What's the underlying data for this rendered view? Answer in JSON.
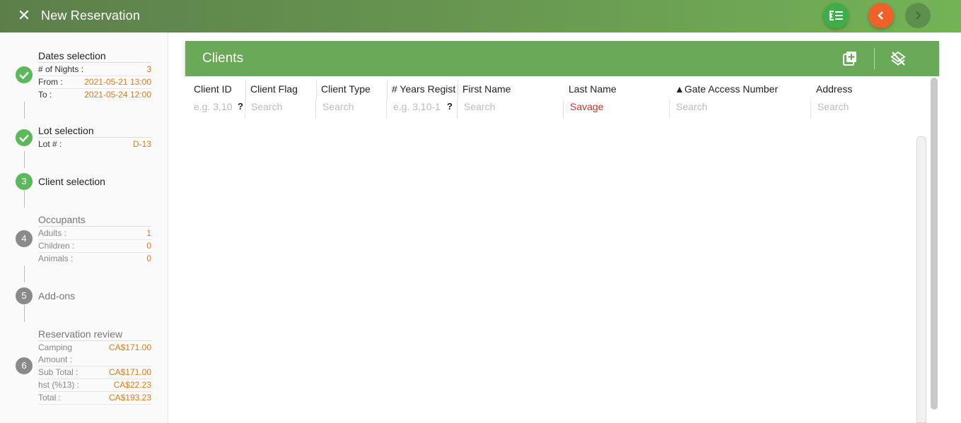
{
  "app": {
    "title": "New Reservation"
  },
  "topbar": {
    "close_icon": "close-icon",
    "buttons": [
      {
        "name": "list-toggle",
        "icon": "list-swap-icon",
        "color": "#3fae49"
      },
      {
        "name": "back",
        "icon": "chevron-left-icon",
        "color": "#f0612a"
      },
      {
        "name": "next",
        "icon": "chevron-right-icon",
        "color": "#5f8f4c"
      }
    ]
  },
  "steps": {
    "dates": {
      "title": "Dates selection",
      "number": "1",
      "status": "done",
      "rows": [
        {
          "key": "# of Nights :",
          "value": "3"
        },
        {
          "key": "From :",
          "value": "2021-05-21 13:00"
        },
        {
          "key": "To :",
          "value": "2021-05-24 12:00"
        }
      ]
    },
    "lot": {
      "title": "Lot selection",
      "number": "2",
      "status": "done",
      "rows": [
        {
          "key": "Lot # :",
          "value": "D-13"
        }
      ]
    },
    "client": {
      "title": "Client selection",
      "number": "3",
      "status": "active"
    },
    "occupants": {
      "title": "Occupants",
      "number": "4",
      "status": "todo",
      "rows": [
        {
          "key": "Adults :",
          "value": "1"
        },
        {
          "key": "Children :",
          "value": "0"
        },
        {
          "key": "Animals :",
          "value": "0"
        }
      ]
    },
    "addons": {
      "title": "Add-ons",
      "number": "5",
      "status": "todo"
    },
    "review": {
      "title": "Reservation review",
      "number": "6",
      "status": "todo",
      "rows": [
        {
          "key": "Camping",
          "value": "CA$171.00"
        },
        {
          "key": "Amount :",
          "value": ""
        },
        {
          "key": "Sub Total :",
          "value": "CA$171.00"
        },
        {
          "key": "hst (%13) :",
          "value": "CA$22.23"
        },
        {
          "key": "Total :",
          "value": "CA$193.23"
        }
      ]
    }
  },
  "panel": {
    "title": "Clients",
    "add_icon": "add-box-icon",
    "clear_filter_icon": "layers-clear-icon",
    "header_color": "#6aa957"
  },
  "table": {
    "columns": [
      {
        "label": "Client ID",
        "filter_placeholder": "e.g. 3,10",
        "filter_value": "",
        "help": "?"
      },
      {
        "label": "Client Flag",
        "filter_placeholder": "Search",
        "filter_value": "",
        "help": ""
      },
      {
        "label": "Client Type",
        "filter_placeholder": "Search",
        "filter_value": "",
        "help": ""
      },
      {
        "label": "# Years Regist",
        "filter_placeholder": "e.g. 3,10-1",
        "filter_value": "",
        "help": "?"
      },
      {
        "label": "First Name",
        "filter_placeholder": "Search",
        "filter_value": "",
        "help": ""
      },
      {
        "label": "Last Name",
        "filter_placeholder": "Search",
        "filter_value": "Savage",
        "help": ""
      },
      {
        "label": "▲Gate Access Number",
        "filter_placeholder": "Search",
        "filter_value": "",
        "help": ""
      },
      {
        "label": "Address",
        "filter_placeholder": "Search",
        "filter_value": "",
        "help": ""
      }
    ],
    "rows": []
  }
}
